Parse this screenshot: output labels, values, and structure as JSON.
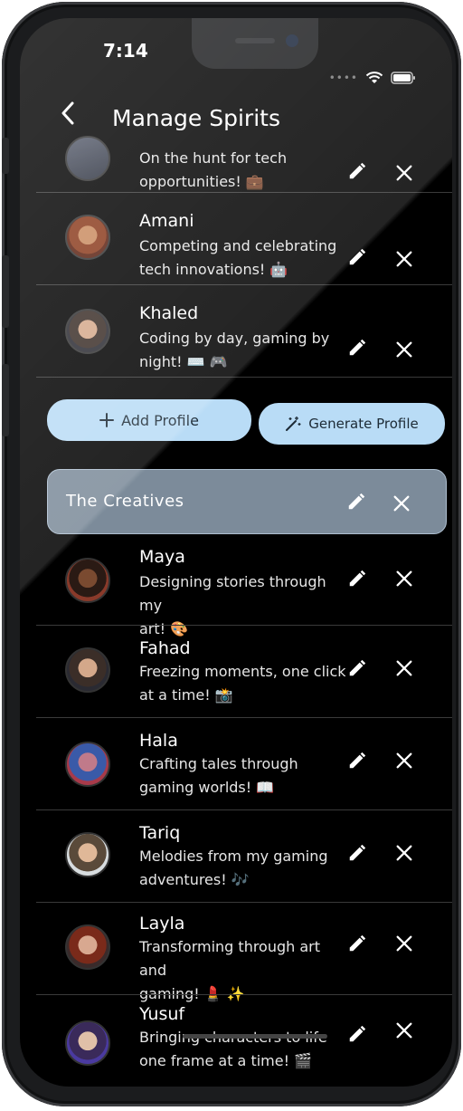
{
  "status": {
    "time": "7:14",
    "dots": "••••"
  },
  "header": {
    "title": "Manage Spirits"
  },
  "top_partial_profile": {
    "bio_line1": "On the hunt for tech",
    "bio_line2": "opportunities! 💼"
  },
  "profiles_group1": [
    {
      "name": "Amani",
      "bio_line1": "Competing and celebrating",
      "bio_line2": "tech innovations! 🤖"
    },
    {
      "name": "Khaled",
      "bio_line1": "Coding by day, gaming by",
      "bio_line2": "night! ⌨️ 🎮"
    }
  ],
  "actions": {
    "add_profile": "Add Profile",
    "generate_profile": "Generate Profile"
  },
  "group": {
    "label": "The Creatives"
  },
  "profiles_group2": [
    {
      "name": "Maya",
      "bio_line1": "Designing stories through my",
      "bio_line2": "art! 🎨"
    },
    {
      "name": "Fahad",
      "bio_line1": "Freezing moments, one click",
      "bio_line2": "at a time! 📸"
    },
    {
      "name": "Hala",
      "bio_line1": "Crafting tales through",
      "bio_line2": "gaming worlds! 📖"
    },
    {
      "name": "Tariq",
      "bio_line1": "Melodies from my gaming",
      "bio_line2": "adventures! 🎶"
    },
    {
      "name": "Layla",
      "bio_line1": "Transforming through art and",
      "bio_line2": "gaming! 💄 ✨"
    },
    {
      "name": "Yusuf",
      "bio_line1": "Bringing characters to life",
      "bio_line2": "one frame at a time! 🎬"
    }
  ],
  "colors": {
    "button_bg": "#b9dcf6",
    "group_bg": "#7c8b9a",
    "screen_bg": "#000000"
  },
  "icons": {
    "back": "chevron-left-icon",
    "edit": "pencil-icon",
    "delete": "close-icon",
    "add": "plus-icon",
    "generate": "magic-wand-icon"
  }
}
